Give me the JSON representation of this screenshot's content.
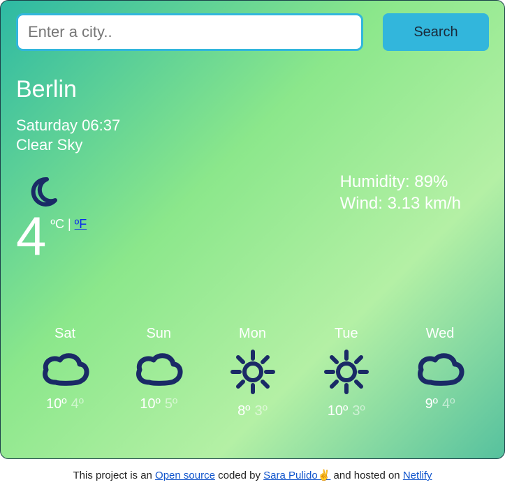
{
  "search": {
    "placeholder": "Enter a city..",
    "button_label": "Search"
  },
  "current": {
    "city": "Berlin",
    "datetime": "Saturday 06:37",
    "condition": "Clear Sky",
    "temperature": "4",
    "unit_c": "ºC",
    "unit_sep": " | ",
    "unit_f": "ºF",
    "humidity_label": "Humidity: ",
    "humidity_value": "89%",
    "wind_label": "Wind: ",
    "wind_value": "3.13 km/h",
    "icon": "moon"
  },
  "forecast": [
    {
      "day": "Sat",
      "icon": "cloud",
      "hi": "10º",
      "lo": "4º"
    },
    {
      "day": "Sun",
      "icon": "cloud",
      "hi": "10º",
      "lo": "5º"
    },
    {
      "day": "Mon",
      "icon": "sun",
      "hi": "8º",
      "lo": "3º"
    },
    {
      "day": "Tue",
      "icon": "sun",
      "hi": "10º",
      "lo": "3º"
    },
    {
      "day": "Wed",
      "icon": "cloud",
      "hi": "9º",
      "lo": "4º"
    }
  ],
  "footer": {
    "prefix": "This project is an ",
    "open_source": "Open source",
    "coded_by": " coded by ",
    "author": "Sara Pulido✌️",
    "hosted": " and hosted on ",
    "host": "Netlify"
  },
  "colors": {
    "icon_stroke": "#1a2a66",
    "accent": "#32b6dc"
  }
}
